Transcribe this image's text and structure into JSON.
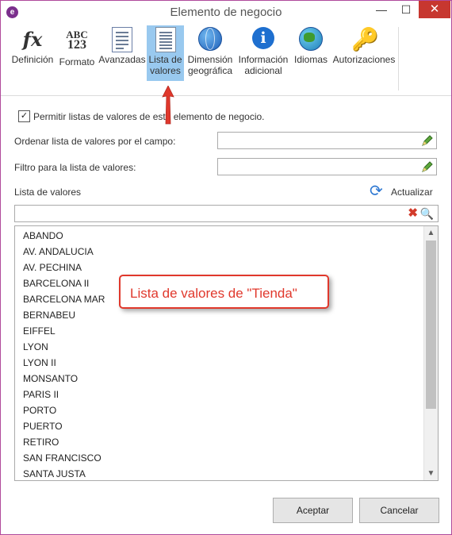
{
  "window": {
    "title": "Elemento de negocio",
    "app_icon_letter": "e",
    "controls": {
      "minimize": "—",
      "maximize": "☐",
      "close": "✕"
    }
  },
  "toolbar": {
    "items": [
      {
        "label": "Definición",
        "icon": "fx-icon",
        "glyph": "fx"
      },
      {
        "label": "Formato",
        "icon": "abc123-icon",
        "glyph_top": "ABC",
        "glyph_bottom": "123"
      },
      {
        "label": "Avanzadas",
        "icon": "advanced-doc-icon"
      },
      {
        "label": "Lista de valores",
        "icon": "list-doc-icon",
        "selected": true
      },
      {
        "label": "Dimensión geográfica",
        "icon": "globe-icon"
      },
      {
        "label": "Información adicional",
        "icon": "info-icon",
        "glyph": "i"
      },
      {
        "label": "Idiomas",
        "icon": "world-icon"
      },
      {
        "label": "Autorizaciones",
        "icon": "key-icon",
        "glyph": "🔑"
      }
    ]
  },
  "form": {
    "allow_checkbox_label": "Permitir listas de valores de este elemento de negocio.",
    "allow_checked": true,
    "check_glyph": "✓",
    "order_label": "Ordenar lista de valores por el campo:",
    "order_value": "",
    "filter_label": "Filtro para la lista de valores:",
    "filter_value": "",
    "list_label": "Lista de valores",
    "refresh_label": "Actualizar",
    "refresh_glyph": "⟳",
    "search_value": "",
    "clear_glyph": "✖",
    "search_glyph": "🔍"
  },
  "values_list": [
    "ABANDO",
    "AV. ANDALUCIA",
    "AV. PECHINA",
    "BARCELONA II",
    "BARCELONA MAR",
    "BERNABEU",
    "EIFFEL",
    "LYON",
    "LYON II",
    "MONSANTO",
    "PARIS II",
    "PORTO",
    "PUERTO",
    "RETIRO",
    "SAN FRANCISCO",
    "SANTA JUSTA"
  ],
  "scroll": {
    "up": "▲",
    "down": "▼"
  },
  "callout": "Lista de valores de \"Tienda\"",
  "buttons": {
    "accept": "Aceptar",
    "cancel": "Cancelar"
  },
  "colors": {
    "selected_tab": "#99c9ef",
    "callout_red": "#e0382c",
    "close_red": "#c7372f",
    "window_border": "#b04a9c"
  }
}
